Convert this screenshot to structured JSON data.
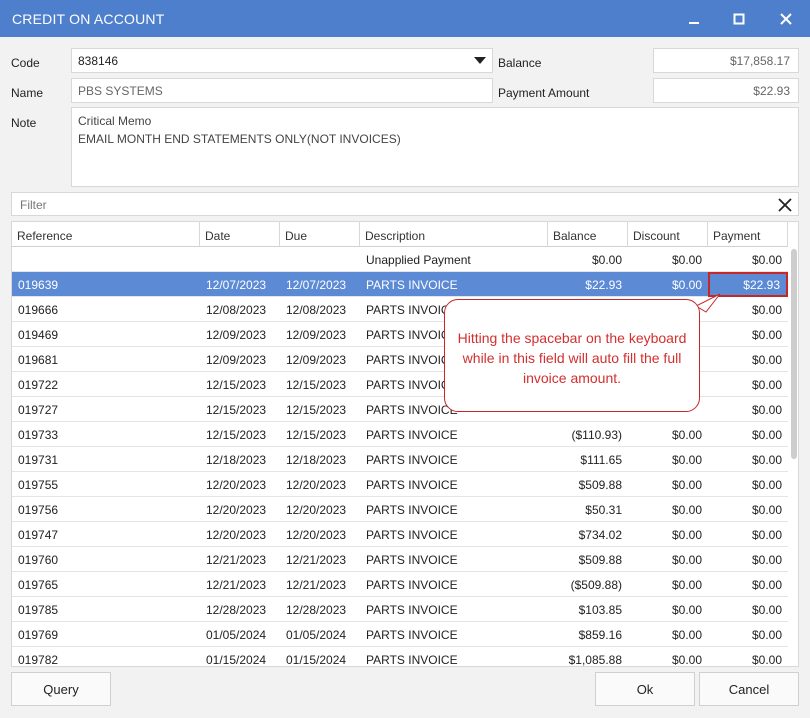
{
  "window": {
    "title": "CREDIT ON ACCOUNT"
  },
  "form": {
    "code_label": "Code",
    "code_value": "838146",
    "name_label": "Name",
    "name_value": "PBS SYSTEMS",
    "note_label": "Note",
    "note_lines": [
      "Critical Memo",
      "EMAIL MONTH END STATEMENTS ONLY(NOT INVOICES)"
    ],
    "balance_label": "Balance",
    "balance_value": "$17,858.17",
    "payment_amount_label": "Payment Amount",
    "payment_amount_value": "$22.93"
  },
  "filter": {
    "placeholder": "Filter"
  },
  "table": {
    "columns": [
      "Reference",
      "Date",
      "Due",
      "Description",
      "Balance",
      "Discount",
      "Payment"
    ],
    "rows": [
      [
        "",
        "",
        "",
        "Unapplied Payment",
        "$0.00",
        "$0.00",
        "$0.00"
      ],
      [
        "019639",
        "12/07/2023",
        "12/07/2023",
        "PARTS INVOICE",
        "$22.93",
        "$0.00",
        "$22.93"
      ],
      [
        "019666",
        "12/08/2023",
        "12/08/2023",
        "PARTS INVOICE",
        "",
        "",
        "$0.00"
      ],
      [
        "019469",
        "12/09/2023",
        "12/09/2023",
        "PARTS INVOICE",
        "",
        "",
        "$0.00"
      ],
      [
        "019681",
        "12/09/2023",
        "12/09/2023",
        "PARTS INVOICE",
        "",
        "",
        "$0.00"
      ],
      [
        "019722",
        "12/15/2023",
        "12/15/2023",
        "PARTS INVOICE",
        "",
        "",
        "$0.00"
      ],
      [
        "019727",
        "12/15/2023",
        "12/15/2023",
        "PARTS INVOICE",
        "",
        "",
        "$0.00"
      ],
      [
        "019733",
        "12/15/2023",
        "12/15/2023",
        "PARTS INVOICE",
        "($110.93)",
        "$0.00",
        "$0.00"
      ],
      [
        "019731",
        "12/18/2023",
        "12/18/2023",
        "PARTS INVOICE",
        "$111.65",
        "$0.00",
        "$0.00"
      ],
      [
        "019755",
        "12/20/2023",
        "12/20/2023",
        "PARTS INVOICE",
        "$509.88",
        "$0.00",
        "$0.00"
      ],
      [
        "019756",
        "12/20/2023",
        "12/20/2023",
        "PARTS INVOICE",
        "$50.31",
        "$0.00",
        "$0.00"
      ],
      [
        "019747",
        "12/20/2023",
        "12/20/2023",
        "PARTS INVOICE",
        "$734.02",
        "$0.00",
        "$0.00"
      ],
      [
        "019760",
        "12/21/2023",
        "12/21/2023",
        "PARTS INVOICE",
        "$509.88",
        "$0.00",
        "$0.00"
      ],
      [
        "019765",
        "12/21/2023",
        "12/21/2023",
        "PARTS INVOICE",
        "($509.88)",
        "$0.00",
        "$0.00"
      ],
      [
        "019785",
        "12/28/2023",
        "12/28/2023",
        "PARTS INVOICE",
        "$103.85",
        "$0.00",
        "$0.00"
      ],
      [
        "019769",
        "01/05/2024",
        "01/05/2024",
        "PARTS INVOICE",
        "$859.16",
        "$0.00",
        "$0.00"
      ],
      [
        "019782",
        "01/15/2024",
        "01/15/2024",
        "PARTS INVOICE",
        "$1,085.88",
        "$0.00",
        "$0.00"
      ]
    ],
    "selected_row": 1
  },
  "callout": {
    "text": "Hitting the spacebar on the keyboard while in this field will auto fill the full invoice amount."
  },
  "buttons": {
    "query": "Query",
    "ok": "Ok",
    "cancel": "Cancel"
  },
  "colors": {
    "titlebar": "#4e7fcd",
    "selected_row": "#5c8ad4",
    "callout": "#d32f2f"
  }
}
